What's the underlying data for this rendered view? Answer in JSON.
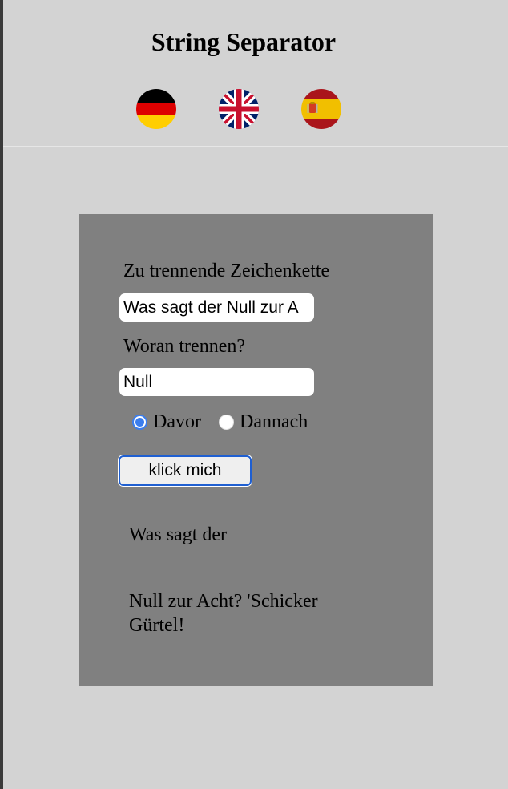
{
  "page": {
    "title": "String Separator"
  },
  "languages": [
    {
      "code": "de",
      "icon": "german-flag-icon"
    },
    {
      "code": "en",
      "icon": "uk-flag-icon"
    },
    {
      "code": "es",
      "icon": "spanish-flag-icon"
    }
  ],
  "form": {
    "string_label": "Zu trennende Zeichenkette",
    "string_value": "Was sagt der Null zur A",
    "separator_label": "Woran trennen?",
    "separator_value": "Null",
    "radio_options": [
      {
        "label": "Davor",
        "checked": true
      },
      {
        "label": "Dannach",
        "checked": false
      }
    ],
    "submit_label": "klick mich"
  },
  "results": [
    "Was sagt der",
    "Null zur Acht? 'Schicker Gürtel!"
  ],
  "colors": {
    "page_background": "#d3d3d3",
    "panel_background": "#808080",
    "accent": "#3b7ded",
    "button_border": "#1f5fd1"
  }
}
